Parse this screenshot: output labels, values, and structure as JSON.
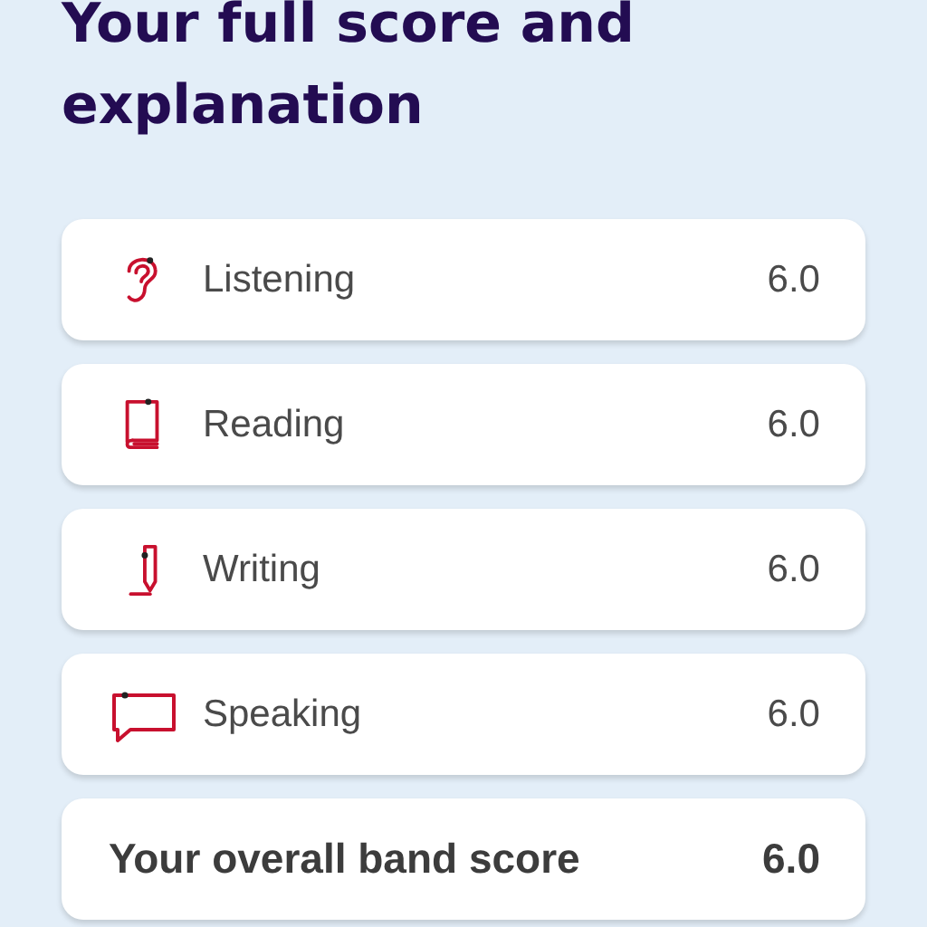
{
  "heading": "Your full score and explanation",
  "scores": [
    {
      "kind": "listening",
      "label": "Listening",
      "score": "6.0"
    },
    {
      "kind": "reading",
      "label": "Reading",
      "score": "6.0"
    },
    {
      "kind": "writing",
      "label": "Writing",
      "score": "6.0"
    },
    {
      "kind": "speaking",
      "label": "Speaking",
      "score": "6.0"
    },
    {
      "kind": "overall",
      "label": "Your overall band score",
      "score": "6.0"
    }
  ]
}
